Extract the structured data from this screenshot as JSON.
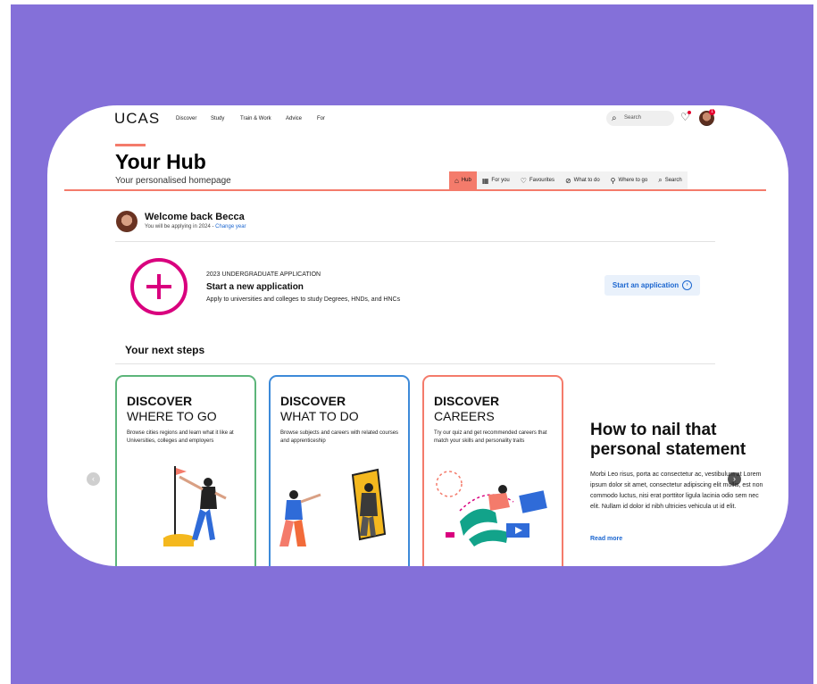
{
  "brand": {
    "logo": "UCAS"
  },
  "nav": {
    "items": [
      "Discover",
      "Study",
      "Train & Work",
      "Advice",
      "For"
    ]
  },
  "search": {
    "placeholder": "Search"
  },
  "notifications": {
    "badge": "1"
  },
  "hub": {
    "title": "Your Hub",
    "subtitle": "Your personalised homepage",
    "tabs": [
      {
        "label": "Hub",
        "icon": "home-icon",
        "active": true
      },
      {
        "label": "For you",
        "icon": "grid-icon"
      },
      {
        "label": "Favourites",
        "icon": "heart-icon"
      },
      {
        "label": "What to do",
        "icon": "compass-icon"
      },
      {
        "label": "Where to go",
        "icon": "location-pin-icon"
      },
      {
        "label": "Search",
        "icon": "search-icon"
      }
    ]
  },
  "welcome": {
    "title": "Welcome back Becca",
    "subtitle": "You will be applying in 2024 -",
    "change_link": "Change year"
  },
  "application": {
    "overline": "2023 UNDERGRADUATE APPLICATION",
    "title": "Start a new application",
    "description": "Apply to universities and colleges to study Degrees, HNDs, and HNCs",
    "button": "Start an application"
  },
  "next_steps": {
    "heading": "Your next steps",
    "cards": [
      {
        "line1": "DISCOVER",
        "line2": "WHERE TO GO",
        "desc": "Browse cities regions and learn what it like at Universities, colleges and employers",
        "border": "#5cb57a"
      },
      {
        "line1": "DISCOVER",
        "line2": "WHAT TO DO",
        "desc": "Browse subjects and careers with related courses and apprenticeship",
        "border": "#3d8ad9"
      },
      {
        "line1": "DISCOVER",
        "line2": "CAREERS",
        "desc": "Try our quiz and get recommended careers that match your skills and personality traits",
        "border": "#f47b6b"
      }
    ]
  },
  "feature": {
    "title": "How to nail that personal statement",
    "body": "Morbi Leo risus, porta ac consectetur ac, vestibulum at Lorem ipsum dolor sit amet, consectetur adipiscing elit mollis, est non commodo luctus, nisi erat porttitor ligula lacinia odio sem nec elit. Nullam id dolor id nibh ultricies vehicula ut id elit.",
    "link": "Read more"
  },
  "colors": {
    "accent": "#f47b6b",
    "magenta": "#d9007e",
    "link": "#1b66d0",
    "background": "#8470d9"
  }
}
